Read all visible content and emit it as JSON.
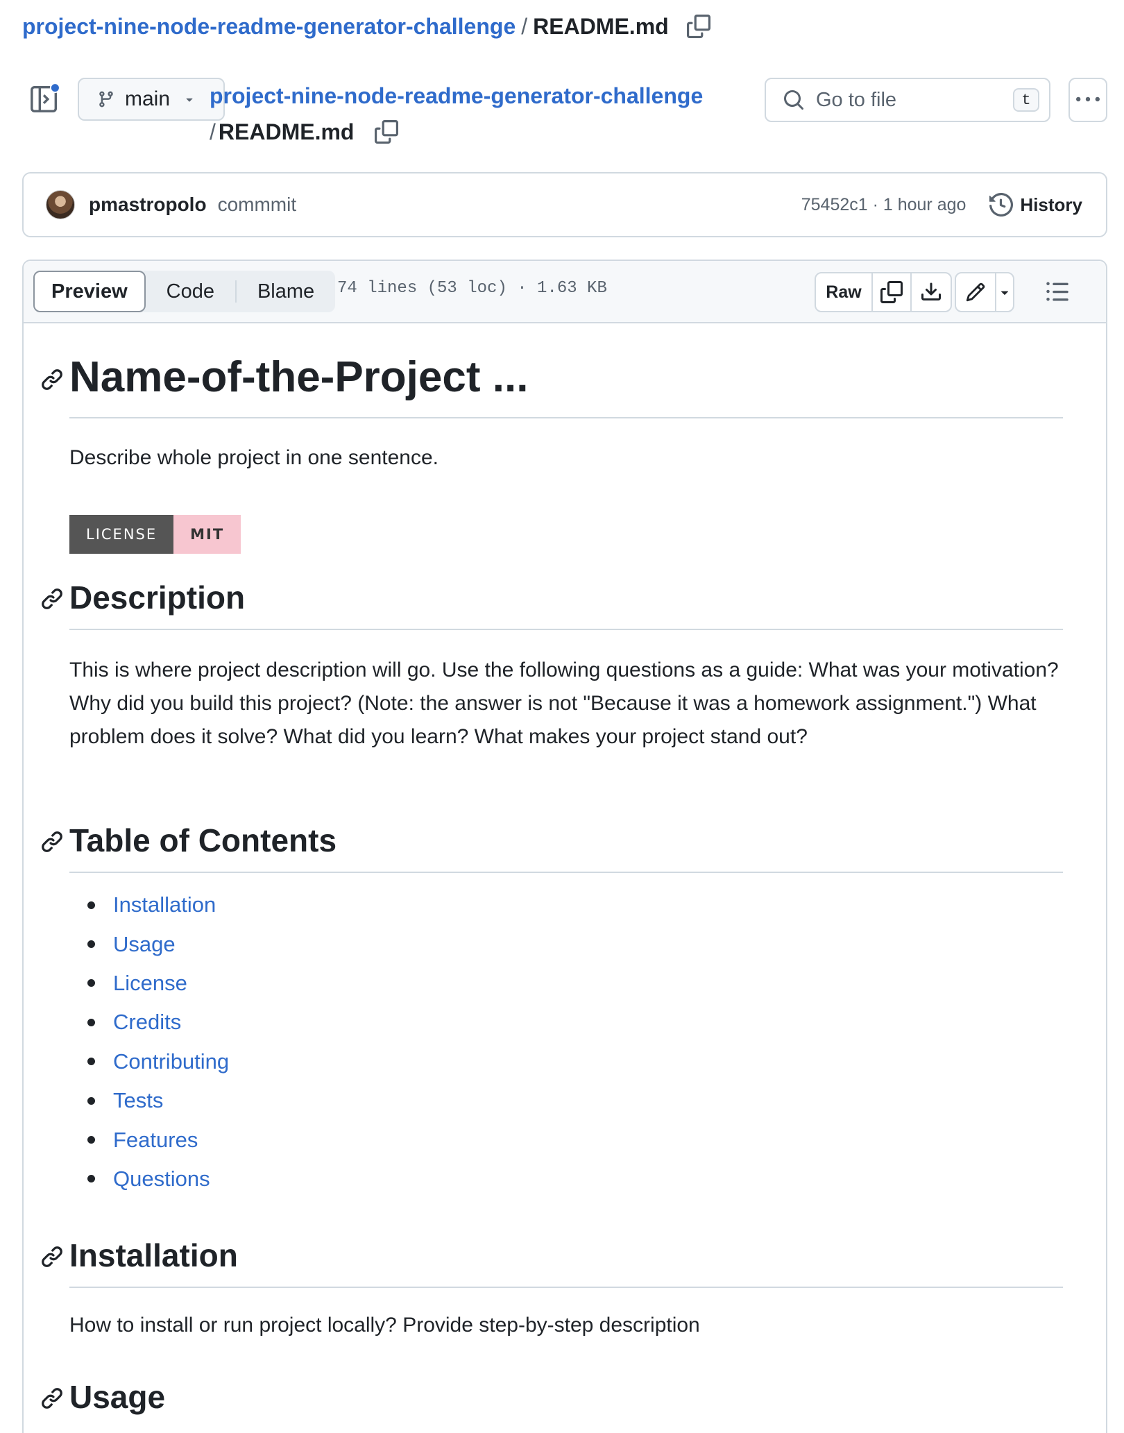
{
  "breadcrumb": {
    "repo": "project-nine-node-readme-generator-challenge",
    "separator": "/",
    "file": "README.md"
  },
  "branch": {
    "label": "main"
  },
  "search": {
    "placeholder": "Go to file",
    "shortcut": "t"
  },
  "commit": {
    "author": "pmastropolo",
    "message": "commmit",
    "meta": "75452c1 · 1 hour ago",
    "history_label": "History"
  },
  "file_header": {
    "tabs": [
      "Preview",
      "Code",
      "Blame"
    ],
    "info": "74 lines (53 loc) · 1.63 KB",
    "raw_label": "Raw"
  },
  "readme": {
    "title": "Name-of-the-Project ...",
    "tagline": "Describe whole project in one sentence.",
    "badge": {
      "label": "LICENSE",
      "value": "MIT"
    },
    "description_heading": "Description",
    "description_text": "This is where project description will go. Use the following questions as a guide: What was your motivation? Why did you build this project? (Note: the answer is not \"Because it was a homework assignment.\") What problem does it solve? What did you learn? What makes your project stand out?",
    "toc_heading": "Table of Contents",
    "toc": [
      "Installation",
      "Usage",
      "License",
      "Credits",
      "Contributing",
      "Tests",
      "Features",
      "Questions"
    ],
    "installation_heading": "Installation",
    "installation_text": "How to install or run project locally? Provide step-by-step description",
    "usage_heading": "Usage"
  },
  "colors": {
    "link": "#2f6bcb",
    "text": "#1f2328",
    "muted": "#59636e",
    "border": "#d1d9e0",
    "badge_left": "#555555",
    "badge_right": "#f7c6d0",
    "notification_dot": "#2f6bcb"
  }
}
